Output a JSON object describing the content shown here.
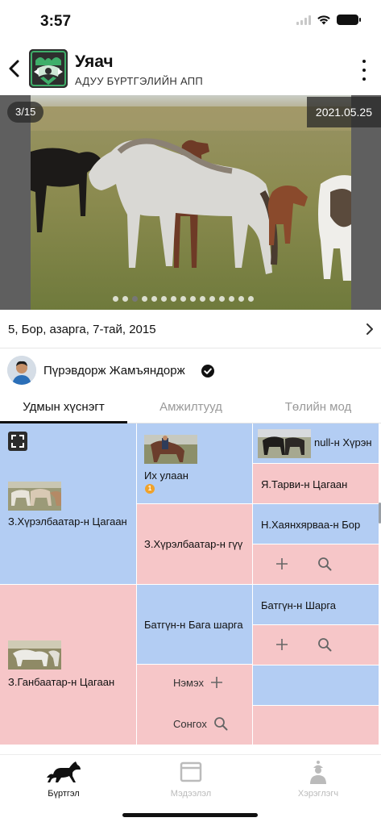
{
  "status": {
    "time": "3:57"
  },
  "header": {
    "title": "Уяач",
    "subtitle": "АДУУ БҮРТГЭЛИЙН АПП",
    "back_icon": "chevron-left-icon",
    "menu_icon": "more-vertical-icon"
  },
  "gallery": {
    "counter": "3/15",
    "date": "2021.05.25",
    "total_images": 15,
    "active_index": 3
  },
  "horse": {
    "summary": "5, Бор, азарга, 7-тай, 2015"
  },
  "owner": {
    "name": "Пүрэвдорж Жамъяндорж",
    "verified": true
  },
  "tabs": [
    {
      "label": "Удмын хүснэгт",
      "active": true
    },
    {
      "label": "Амжилтууд",
      "active": false
    },
    {
      "label": "Төлийн мод",
      "active": false
    }
  ],
  "pedigree": {
    "sire": "З.Хүрэлбаатар-н Цагаан",
    "dam": "З.Ганбаатар-н Цагаан",
    "sire_sire": "Их улаан",
    "sire_sire_badge": "1",
    "sire_dam": "З.Хүрэлбаатар-н гүү",
    "dam_sire": "Батгүн-н Бага шарга",
    "add_label": "Нэмэх",
    "select_label": "Сонгох",
    "gen3": [
      "null-н Хүрэн",
      "Я.Тарви-н Цагаан",
      "Н.Хаянхярваа-н Бор",
      "",
      "Батгүн-н Шарга",
      "",
      "",
      ""
    ]
  },
  "bottom_nav": [
    {
      "label": "Бүртгэл",
      "icon": "horse-icon",
      "active": true
    },
    {
      "label": "Мэдээлэл",
      "icon": "browser-window-icon",
      "active": false
    },
    {
      "label": "Хэрэглэгч",
      "icon": "user-figure-icon",
      "active": false
    }
  ],
  "colors": {
    "male_cell": "#b3cdf3",
    "female_cell": "#f6c6c8",
    "badge": "#f0a22a"
  }
}
